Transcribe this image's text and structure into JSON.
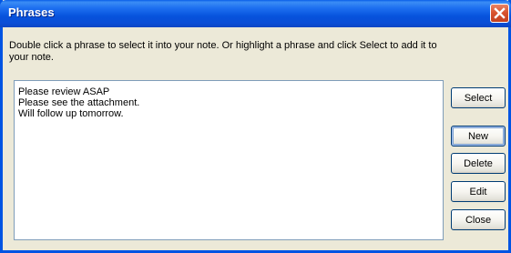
{
  "window": {
    "title": "Phrases",
    "close_label": "Close window",
    "colors": {
      "titlebar": "#0054e3",
      "face": "#ece9d8",
      "close": "#d9542f"
    }
  },
  "instructions": "Double click a phrase to select it into your note. Or highlight a phrase and click Select to add it to your note.",
  "phrases": [
    "Please review ASAP",
    "Please see the attachment.",
    "Will follow up tomorrow."
  ],
  "buttons": {
    "select": "Select",
    "new": "New",
    "delete": "Delete",
    "edit": "Edit",
    "close": "Close"
  },
  "icons": {
    "close": "close-icon"
  }
}
